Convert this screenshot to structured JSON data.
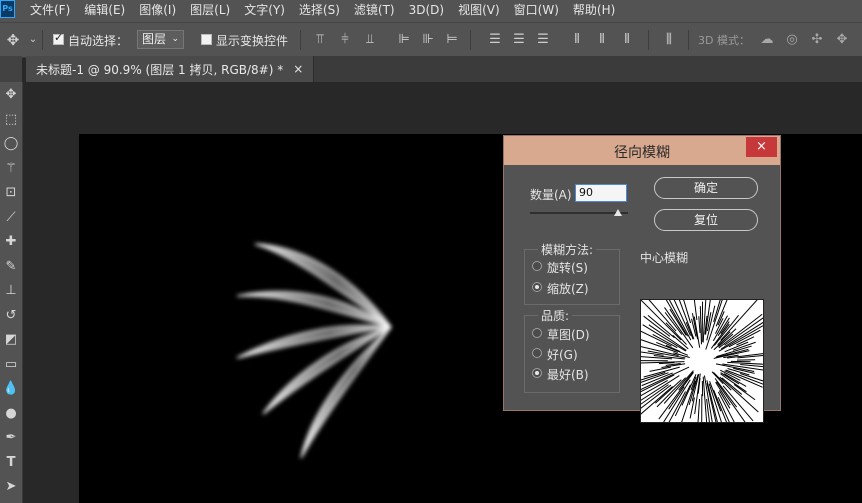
{
  "app": {
    "logo_text": "Ps"
  },
  "menu": [
    "文件(F)",
    "编辑(E)",
    "图像(I)",
    "图层(L)",
    "文字(Y)",
    "选择(S)",
    "滤镜(T)",
    "3D(D)",
    "视图(V)",
    "窗口(W)",
    "帮助(H)"
  ],
  "options": {
    "auto_select_label": "自动选择：",
    "auto_select_checked": true,
    "target_value": "图层",
    "show_transform_label": "显示变换控件",
    "show_transform_checked": false,
    "mode_3d_label": "3D 模式："
  },
  "tab": {
    "title": "未标题-1 @ 90.9% (图层 1 拷贝, RGB/8#) *",
    "close": "×"
  },
  "dialog": {
    "title": "径向模糊",
    "close": "×",
    "amount_label": "数量(A)",
    "amount_value": "90",
    "ok_label": "确定",
    "reset_label": "复位",
    "method_group": "模糊方法:",
    "method_options": [
      {
        "label": "旋转(S)",
        "selected": false
      },
      {
        "label": "缩放(Z)",
        "selected": true
      }
    ],
    "quality_group": "品质:",
    "quality_options": [
      {
        "label": "草图(D)",
        "selected": false
      },
      {
        "label": "好(G)",
        "selected": false
      },
      {
        "label": "最好(B)",
        "selected": true
      }
    ],
    "center_label": "中心模糊",
    "amount_slider": 0.9
  },
  "colors": {
    "dialog_title_bg": "#d8a98e",
    "close_bg": "#c7383a",
    "accent_input": "#4a8ad6"
  }
}
